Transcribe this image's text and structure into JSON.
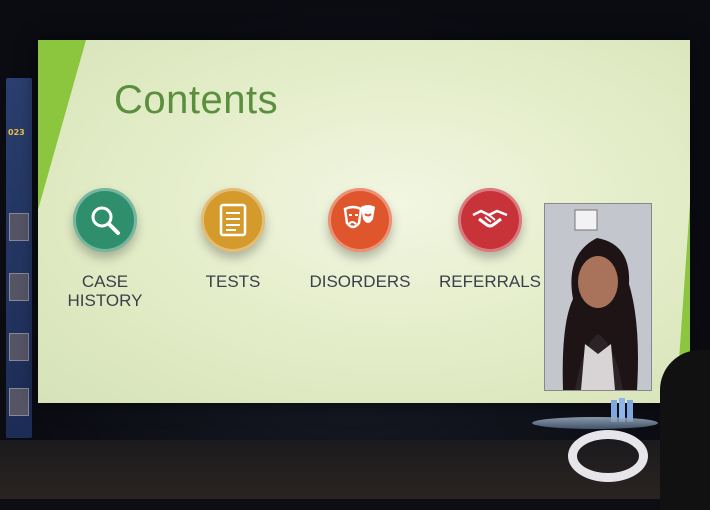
{
  "slide": {
    "title": "Contents",
    "items": [
      {
        "label_lines": [
          "CASE",
          "HISTORY"
        ],
        "icon": "magnifier-icon",
        "color": "#2f8f6c"
      },
      {
        "label_lines": [
          "TESTS"
        ],
        "icon": "checklist-icon",
        "color": "#d59a2c"
      },
      {
        "label_lines": [
          "DISORDERS"
        ],
        "icon": "theater-masks-icon",
        "color": "#e0562c"
      },
      {
        "label_lines": [
          "REFERRALS"
        ],
        "icon": "handshake-icon",
        "color": "#c8333a"
      }
    ],
    "accent_color": "#8cc63f",
    "title_color": "#5b8f3e"
  },
  "side_banner": {
    "year_fragment": "023"
  }
}
